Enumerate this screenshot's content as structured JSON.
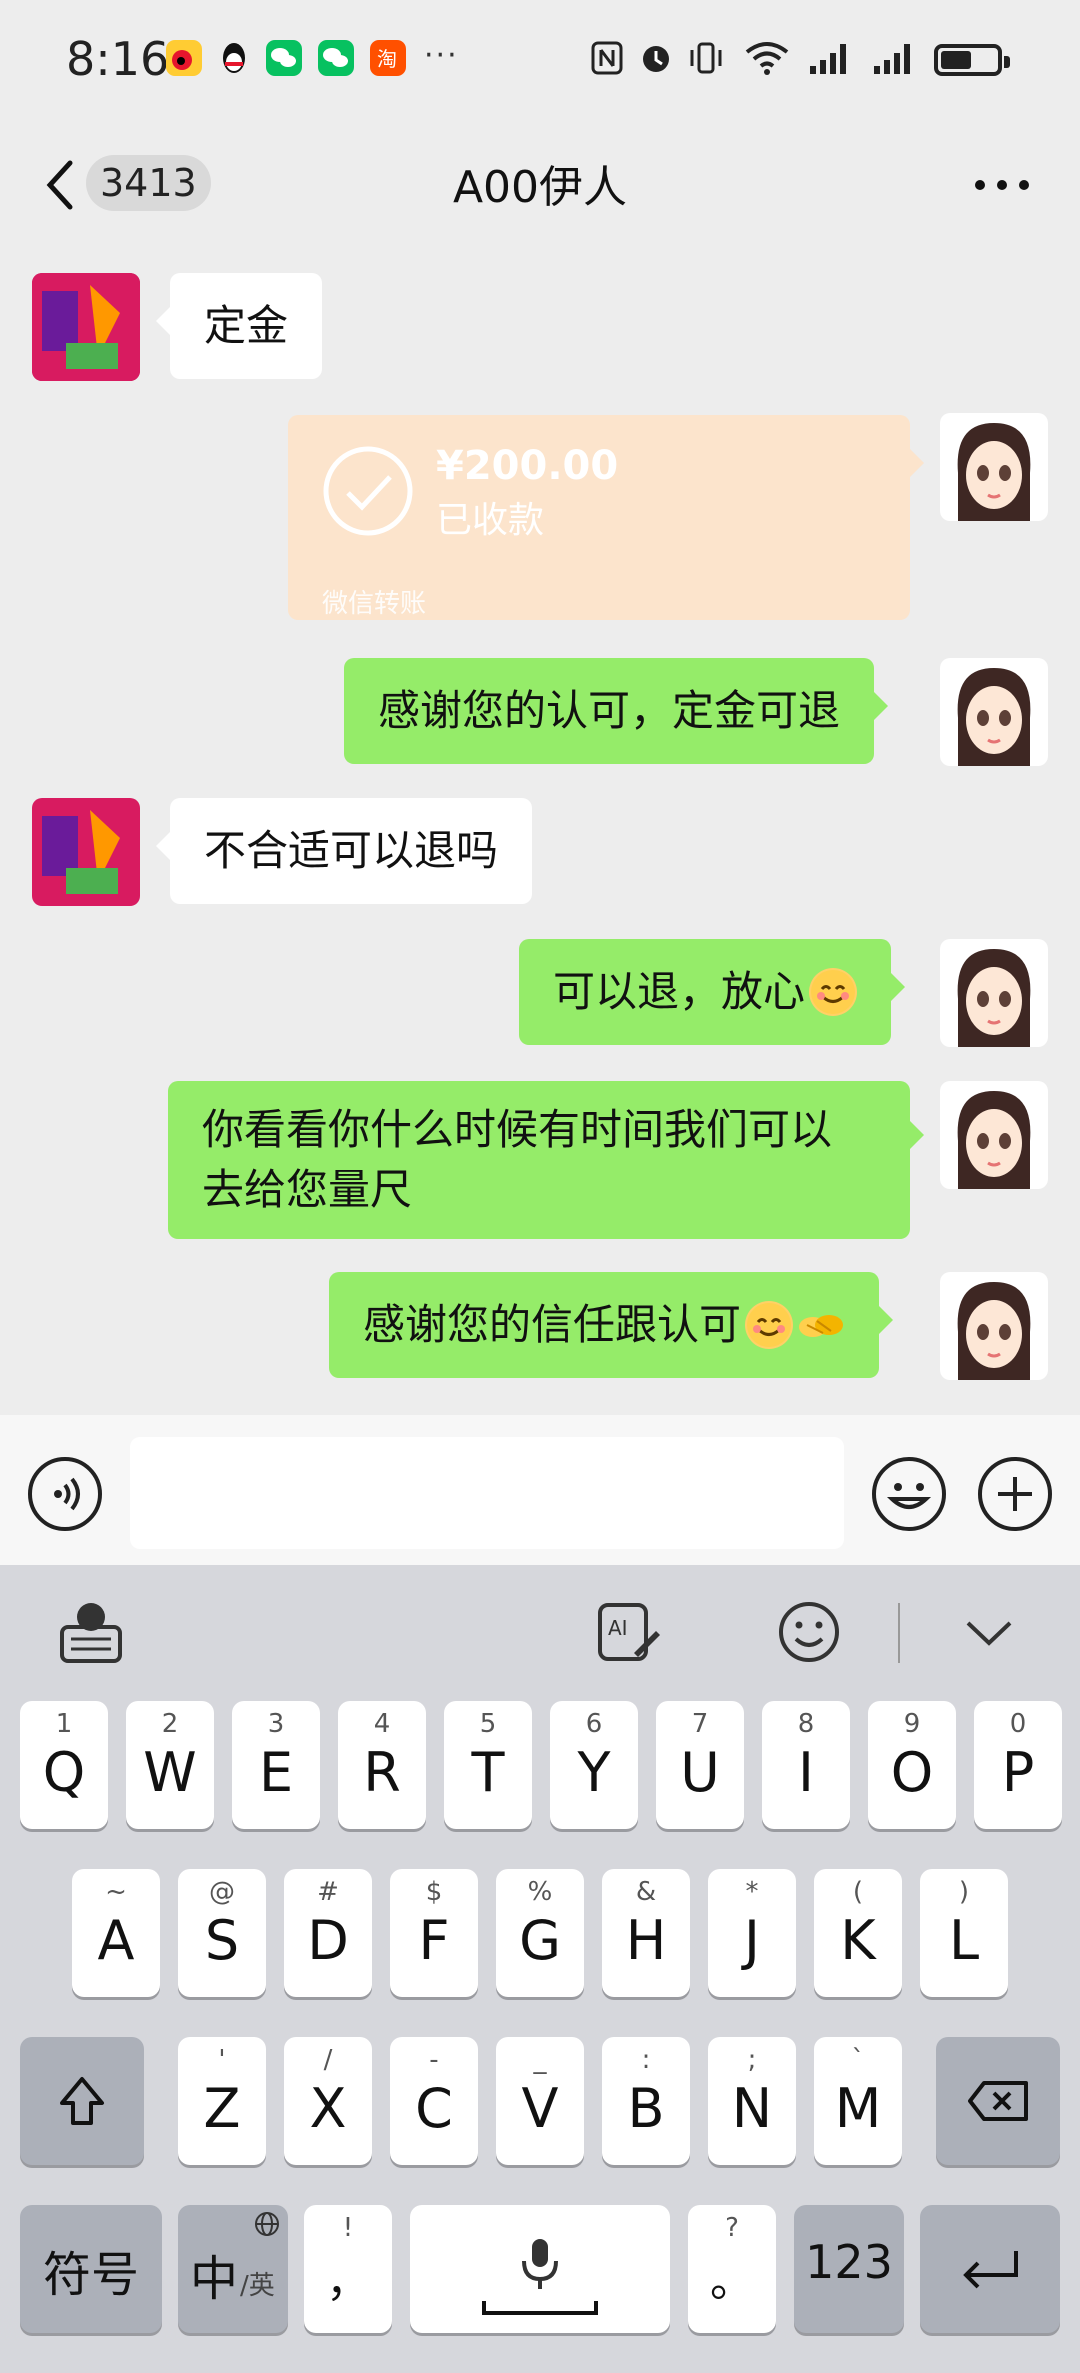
{
  "status_bar": {
    "time": "8:16",
    "notification_icons": [
      "weibo-icon",
      "qq-icon",
      "wechat-icon",
      "wechat-icon",
      "taobao-icon"
    ],
    "more": "···",
    "system_icons": [
      "nfc-icon",
      "alarm-icon",
      "vibrate-icon",
      "wifi-icon",
      "signal-icon",
      "signal-icon",
      "battery-icon"
    ],
    "battery_level": 0.55
  },
  "header": {
    "back_icon": "chevron-left-icon",
    "unread_count": "3413",
    "title": "A00伊人",
    "more_icon": "more-dots-icon"
  },
  "messages": [
    {
      "side": "left",
      "text": "定金"
    },
    {
      "side": "right",
      "type": "transfer",
      "amount": "¥200.00",
      "status": "已收款",
      "footer": "微信转账"
    },
    {
      "side": "right",
      "text": "感谢您的认可，定金可退"
    },
    {
      "side": "left",
      "text": "不合适可以退吗"
    },
    {
      "side": "right",
      "text": "可以退，放心",
      "emojis": [
        "smile-emoji"
      ]
    },
    {
      "side": "right",
      "text_line1": "你看看你什么时候有时间我们可以",
      "text_line2": "去给您量尺"
    },
    {
      "side": "right",
      "text": "感谢您的信任跟认可",
      "emojis": [
        "smile-emoji",
        "handshake-emoji"
      ]
    }
  ],
  "input_bar": {
    "voice_icon": "voice-icon",
    "input_value": "",
    "emoji_icon": "emoji-icon",
    "plus_icon": "plus-icon"
  },
  "keyboard": {
    "toolbar": [
      "keyboard-settings-icon",
      "ai-write-icon",
      "emoji-icon",
      "collapse-icon"
    ],
    "row1": [
      {
        "hint": "1",
        "key": "Q"
      },
      {
        "hint": "2",
        "key": "W"
      },
      {
        "hint": "3",
        "key": "E"
      },
      {
        "hint": "4",
        "key": "R"
      },
      {
        "hint": "5",
        "key": "T"
      },
      {
        "hint": "6",
        "key": "Y"
      },
      {
        "hint": "7",
        "key": "U"
      },
      {
        "hint": "8",
        "key": "I"
      },
      {
        "hint": "9",
        "key": "O"
      },
      {
        "hint": "0",
        "key": "P"
      }
    ],
    "row2": [
      {
        "hint": "~",
        "key": "A"
      },
      {
        "hint": "@",
        "key": "S"
      },
      {
        "hint": "#",
        "key": "D"
      },
      {
        "hint": "$",
        "key": "F"
      },
      {
        "hint": "%",
        "key": "G"
      },
      {
        "hint": "&",
        "key": "H"
      },
      {
        "hint": "*",
        "key": "J"
      },
      {
        "hint": "(",
        "key": "K"
      },
      {
        "hint": ")",
        "key": "L"
      }
    ],
    "row3": [
      {
        "hint": "'",
        "key": "Z"
      },
      {
        "hint": "/",
        "key": "X"
      },
      {
        "hint": "-",
        "key": "C"
      },
      {
        "hint": "_",
        "key": "V"
      },
      {
        "hint": ":",
        "key": "B"
      },
      {
        "hint": ";",
        "key": "N"
      },
      {
        "hint": "`",
        "key": "M"
      }
    ],
    "symbols_label": "符号",
    "lang_label": "中",
    "lang_sub": "/英",
    "comma_hint": "!",
    "comma": "，",
    "period_hint": "?",
    "period": "。",
    "num_label": "123"
  }
}
